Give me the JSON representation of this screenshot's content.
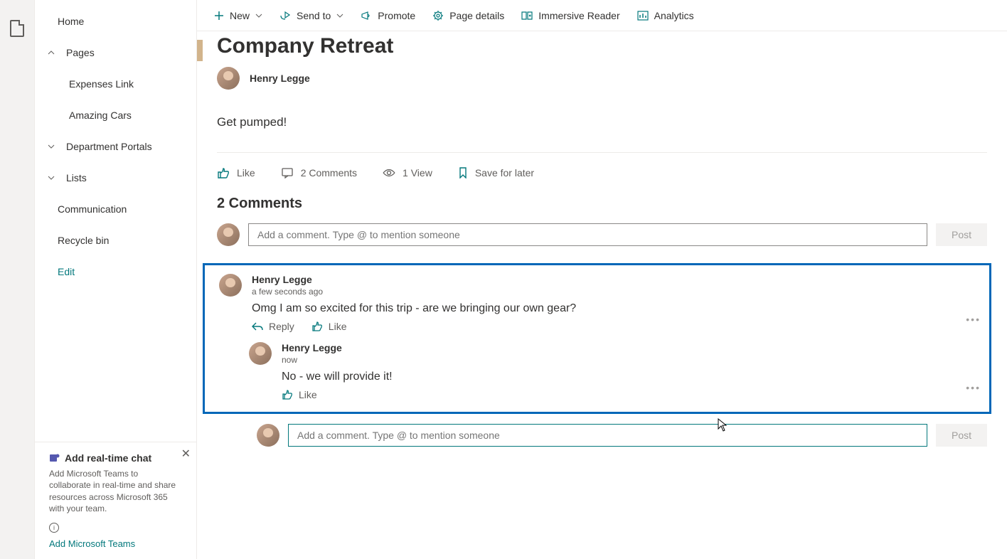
{
  "sidebar": {
    "items": [
      {
        "label": "Home"
      },
      {
        "label": "Pages"
      },
      {
        "label": "Expenses Link"
      },
      {
        "label": "Amazing Cars"
      },
      {
        "label": "Department Portals"
      },
      {
        "label": "Lists"
      },
      {
        "label": "Communication"
      },
      {
        "label": "Recycle bin"
      }
    ],
    "edit": "Edit"
  },
  "promo": {
    "title": "Add real-time chat",
    "text": "Add Microsoft Teams to collaborate in real-time and share resources across Microsoft 365 with your team.",
    "link": "Add Microsoft Teams"
  },
  "toolbar": {
    "new": "New",
    "send": "Send to",
    "promote": "Promote",
    "details": "Page details",
    "reader": "Immersive Reader",
    "analytics": "Analytics"
  },
  "page": {
    "title": "Company Retreat",
    "author": "Henry Legge",
    "body": "Get pumped!"
  },
  "stats": {
    "like": "Like",
    "comments": "2 Comments",
    "views": "1 View",
    "save": "Save for later"
  },
  "comments": {
    "header": "2 Comments",
    "placeholder": "Add a comment. Type @ to mention someone",
    "post": "Post",
    "reply": "Reply",
    "like": "Like",
    "list": [
      {
        "author": "Henry Legge",
        "time": "a few seconds ago",
        "text": "Omg I am so excited for this trip - are we bringing our own gear?"
      },
      {
        "author": "Henry Legge",
        "time": "now",
        "text": "No - we will provide it!"
      }
    ]
  }
}
